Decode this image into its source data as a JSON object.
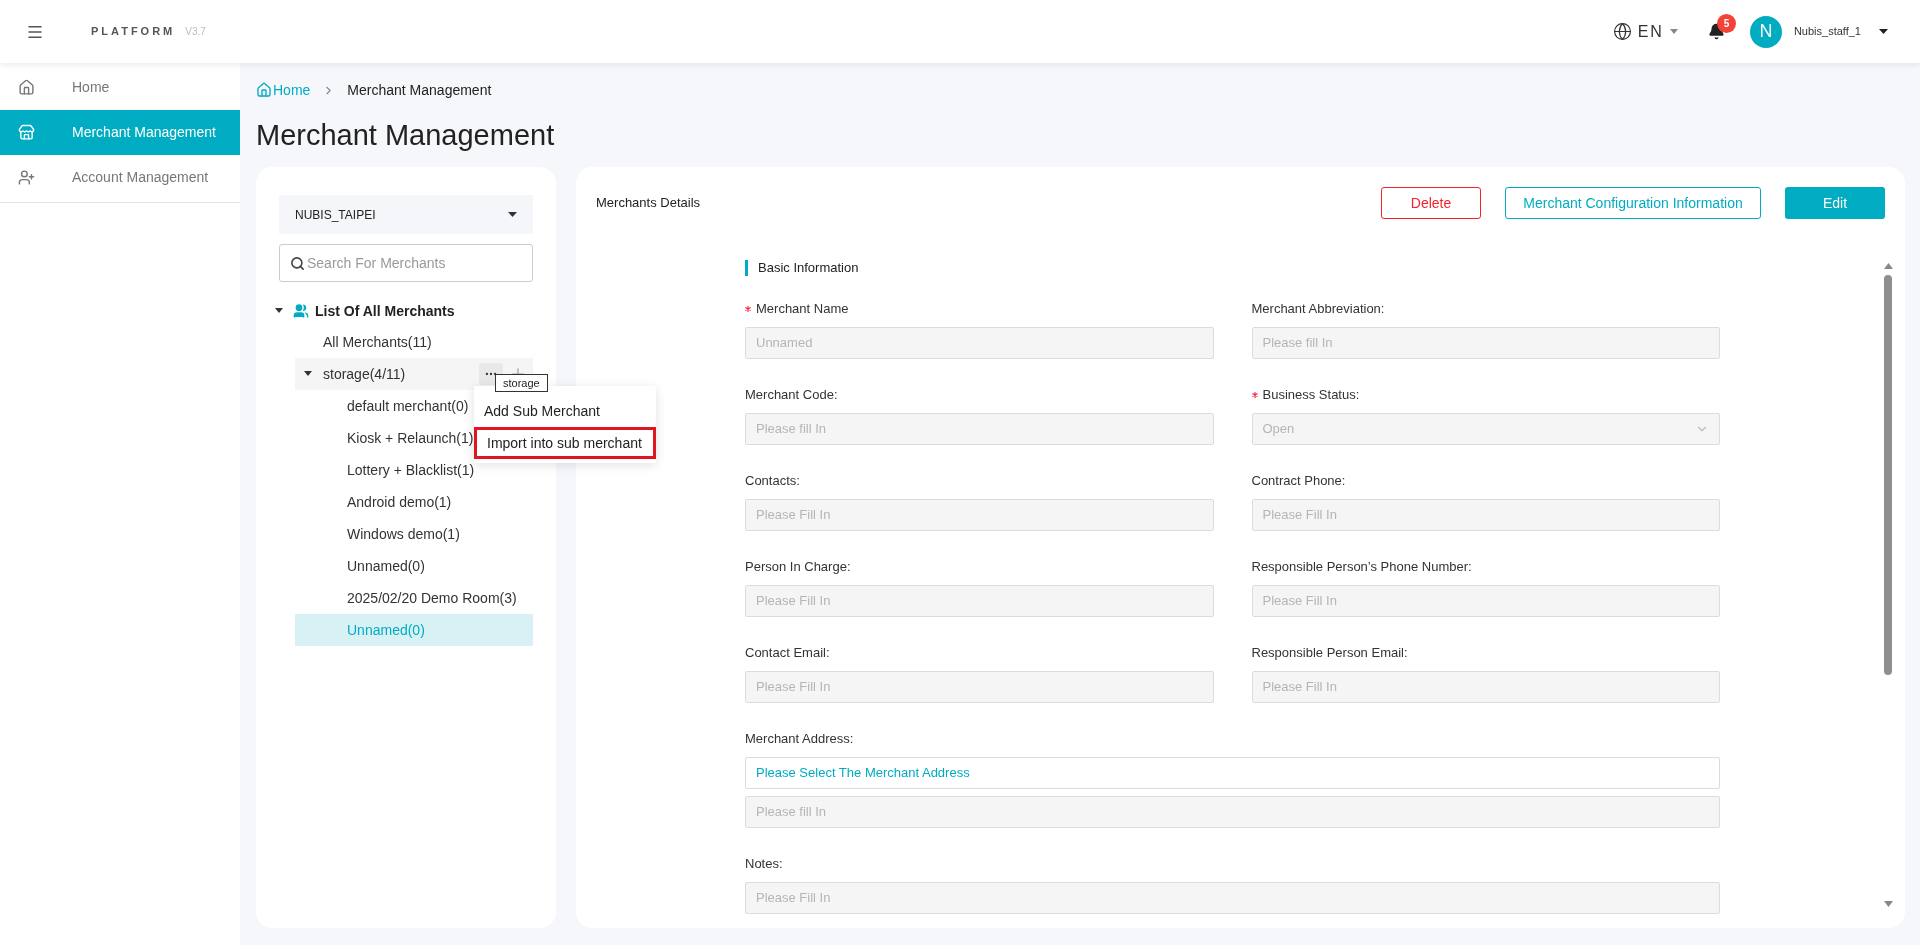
{
  "header": {
    "brand": "PLATFORM",
    "version": "V3.7",
    "language": "EN",
    "notification_count": "5",
    "avatar_initial": "N",
    "user": "Nubis_staff_1"
  },
  "sidebar": {
    "items": [
      {
        "label": "Home",
        "kind": "home",
        "selected": false
      },
      {
        "label": "Merchant Management",
        "kind": "store",
        "selected": true
      },
      {
        "label": "Account Management",
        "kind": "users",
        "selected": false
      }
    ]
  },
  "breadcrumb": [
    "Home",
    "Merchant Management"
  ],
  "page_title": "Merchant Management",
  "merchant_tree": {
    "organization": "NUBIS_TAIPEI",
    "search": {
      "placeholder": "Search For Merchants"
    },
    "root": {
      "label": "List Of All Merchants",
      "expanded": true,
      "children": [
        {
          "label": "All Merchants(11)",
          "selected": false
        },
        {
          "label": "storage(4/11)",
          "expanded": true,
          "hovered": true,
          "selected": false,
          "children": [
            {
              "label": "default merchant(0)",
              "selected": false
            },
            {
              "label": "Kiosk + Relaunch(1)",
              "selected": false
            },
            {
              "label": "Lottery + Blacklist(1)",
              "selected": false
            },
            {
              "label": "Android demo(1)",
              "selected": false
            },
            {
              "label": "Windows demo(1)",
              "selected": false
            },
            {
              "label": "Unnamed(0)",
              "selected": false
            },
            {
              "label": "2025/02/20 Demo Room(3)",
              "selected": false
            },
            {
              "label": "Unnamed(0)",
              "selected": true
            }
          ]
        }
      ]
    }
  },
  "context_menu": {
    "tooltip": "storage",
    "items": [
      {
        "label": "Add Sub Merchant",
        "highlighted": false
      },
      {
        "label": "Import into sub merchant",
        "highlighted": true
      }
    ]
  },
  "details": {
    "title": "Merchants Details",
    "buttons": [
      {
        "label": "Delete",
        "kind": "danger"
      },
      {
        "label": "Merchant Configuration Information",
        "kind": "outline"
      },
      {
        "label": "Edit",
        "kind": "primary"
      }
    ],
    "section": "Basic Information",
    "fields": [
      {
        "label": "Merchant Name",
        "kind": "text",
        "required": true,
        "value": "Unnamed"
      },
      {
        "label": "Merchant Abbreviation:",
        "kind": "text",
        "required": false,
        "placeholder": "Please fill In"
      },
      {
        "label": "Merchant Code:",
        "kind": "text",
        "required": false,
        "placeholder": "Please fill In"
      },
      {
        "label": "Business Status:",
        "kind": "select",
        "required": true,
        "value": "Open"
      },
      {
        "label": "Contacts:",
        "kind": "text",
        "required": false,
        "placeholder": "Please Fill In"
      },
      {
        "label": "Contract Phone:",
        "kind": "text",
        "required": false,
        "placeholder": "Please Fill In"
      },
      {
        "label": "Person In Charge:",
        "kind": "text",
        "required": false,
        "placeholder": "Please Fill In"
      },
      {
        "label": "Responsible Person’s Phone Number:",
        "kind": "text",
        "required": false,
        "placeholder": "Please Fill In"
      },
      {
        "label": "Contact Email:",
        "kind": "text",
        "required": false,
        "placeholder": "Please Fill In"
      },
      {
        "label": "Responsible Person Email:",
        "kind": "text",
        "required": false,
        "placeholder": "Please Fill In"
      },
      {
        "label": "Merchant Address:",
        "kind": "address",
        "required": false,
        "link": "Please Select The Merchant Address",
        "placeholder": "Please fill In"
      },
      {
        "label": "Notes:",
        "kind": "wide",
        "required": false,
        "placeholder": "Please Fill In"
      }
    ]
  }
}
